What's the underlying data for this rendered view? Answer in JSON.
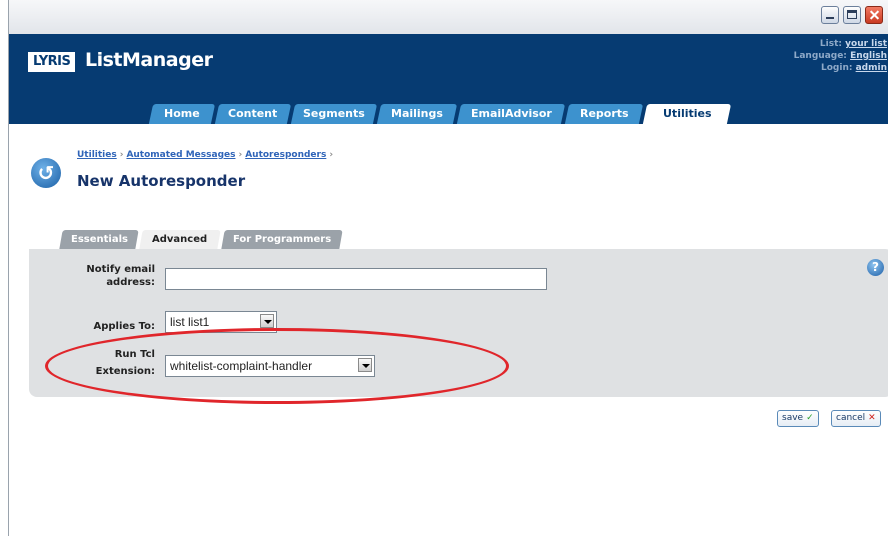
{
  "window": {
    "controls": [
      "minimize-icon",
      "maximize-icon",
      "close-icon"
    ]
  },
  "header": {
    "logo_box": "LYRIS",
    "logo_text": "ListManager",
    "list_label": "List:",
    "list_value": "your list",
    "language_label": "Language:",
    "language_value": "English",
    "login_label": "Login:",
    "login_value": "admin"
  },
  "main_tabs": [
    {
      "label": "Home"
    },
    {
      "label": "Content"
    },
    {
      "label": "Segments"
    },
    {
      "label": "Mailings"
    },
    {
      "label": "EmailAdvisor"
    },
    {
      "label": "Reports"
    },
    {
      "label": "Utilities",
      "active": true
    }
  ],
  "breadcrumb": {
    "items": [
      "Utilities",
      "Automated Messages",
      "Autoresponders"
    ],
    "separator": "›"
  },
  "page": {
    "title": "New Autoresponder"
  },
  "sub_tabs": [
    {
      "label": "Essentials"
    },
    {
      "label": "Advanced",
      "active": true
    },
    {
      "label": "For Programmers"
    }
  ],
  "form": {
    "notify_label_line1": "Notify email",
    "notify_label_line2": "address:",
    "notify_value": "",
    "applies_label": "Applies To:",
    "applies_value": "list list1",
    "tcl_label_line1": "Run Tcl",
    "tcl_label_line2": "Extension:",
    "tcl_value": "whitelist-complaint-handler"
  },
  "actions": {
    "save_label": "save",
    "save_icon": "✓",
    "cancel_label": "cancel",
    "cancel_icon": "✕"
  },
  "colors": {
    "header_bg": "#063b72",
    "tab_bg": "#3d92ce",
    "highlight_ellipse": "#e0262b"
  }
}
